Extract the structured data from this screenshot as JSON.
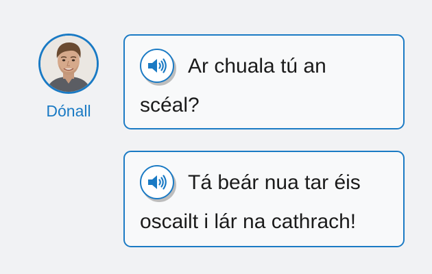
{
  "colors": {
    "accent": "#1a7ac4",
    "background": "#f1f2f4",
    "bubble_background": "#f8f9fa",
    "text": "#1b1b1b"
  },
  "speaker": {
    "name": "Dónall",
    "avatar_icon": "person-portrait"
  },
  "messages": [
    {
      "audio_icon": "speaker-icon",
      "text": "Ar chuala tú an scéal?"
    },
    {
      "audio_icon": "speaker-icon",
      "text": "Tá beár nua tar éis oscailt i lár na cathrach!"
    }
  ]
}
